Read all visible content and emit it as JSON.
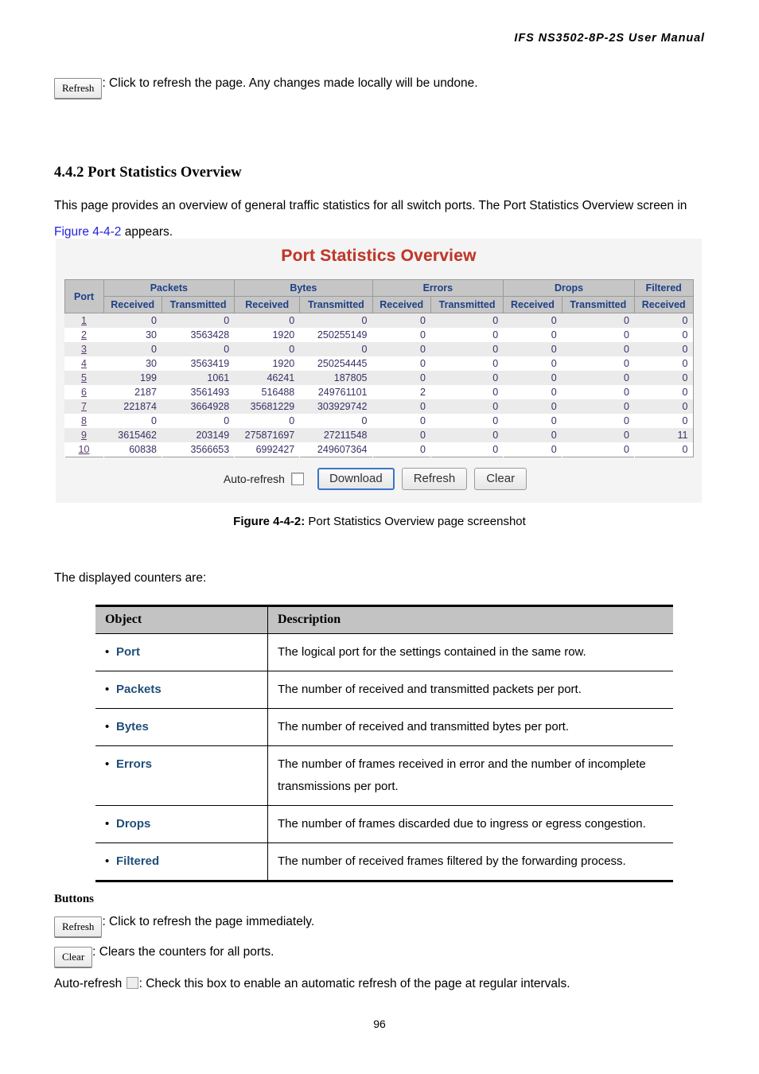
{
  "doc": {
    "running_header": "IFS  NS3502-8P-2S  User  Manual",
    "page_number": "96"
  },
  "intro": {
    "refresh_button_label": "Refresh",
    "refresh_text": ": Click to refresh the page. Any changes made locally will be undone.",
    "section_heading": "4.4.2 Port Statistics Overview",
    "paragraph_part1": "This page provides an overview of general traffic statistics for all switch ports. The Port Statistics Overview screen in ",
    "paragraph_link": "Figure 4-4-2",
    "paragraph_part2": " appears."
  },
  "figure": {
    "screen_title": "Port Statistics Overview",
    "caption_label": "Figure 4-4-2:",
    "caption_text": " Port Statistics Overview page screenshot",
    "controls": {
      "auto_refresh_label": "Auto-refresh",
      "download_label": "Download",
      "refresh_label": "Refresh",
      "clear_label": "Clear"
    },
    "table": {
      "port_header": "Port",
      "group_headers": [
        "Packets",
        "Bytes",
        "Errors",
        "Drops",
        "Filtered"
      ],
      "sub_headers": [
        "Received",
        "Transmitted",
        "Received",
        "Transmitted",
        "Received",
        "Transmitted",
        "Received",
        "Transmitted",
        "Received"
      ],
      "rows": [
        {
          "port": "1",
          "cells": [
            "0",
            "0",
            "0",
            "0",
            "0",
            "0",
            "0",
            "0",
            "0"
          ]
        },
        {
          "port": "2",
          "cells": [
            "30",
            "3563428",
            "1920",
            "250255149",
            "0",
            "0",
            "0",
            "0",
            "0"
          ]
        },
        {
          "port": "3",
          "cells": [
            "0",
            "0",
            "0",
            "0",
            "0",
            "0",
            "0",
            "0",
            "0"
          ]
        },
        {
          "port": "4",
          "cells": [
            "30",
            "3563419",
            "1920",
            "250254445",
            "0",
            "0",
            "0",
            "0",
            "0"
          ]
        },
        {
          "port": "5",
          "cells": [
            "199",
            "1061",
            "46241",
            "187805",
            "0",
            "0",
            "0",
            "0",
            "0"
          ]
        },
        {
          "port": "6",
          "cells": [
            "2187",
            "3561493",
            "516488",
            "249761101",
            "2",
            "0",
            "0",
            "0",
            "0"
          ]
        },
        {
          "port": "7",
          "cells": [
            "221874",
            "3664928",
            "35681229",
            "303929742",
            "0",
            "0",
            "0",
            "0",
            "0"
          ]
        },
        {
          "port": "8",
          "cells": [
            "0",
            "0",
            "0",
            "0",
            "0",
            "0",
            "0",
            "0",
            "0"
          ]
        },
        {
          "port": "9",
          "cells": [
            "3615462",
            "203149",
            "275871697",
            "27211548",
            "0",
            "0",
            "0",
            "0",
            "11"
          ]
        },
        {
          "port": "10",
          "cells": [
            "60838",
            "3566653",
            "6992427",
            "249607364",
            "0",
            "0",
            "0",
            "0",
            "0"
          ]
        }
      ]
    }
  },
  "counters": {
    "lead_in": "The displayed counters are:",
    "headers": [
      "Object",
      "Description"
    ],
    "rows": [
      {
        "object": "Port",
        "description": "The logical port for the settings contained in the same row."
      },
      {
        "object": "Packets",
        "description": "The number of received and transmitted packets per port."
      },
      {
        "object": "Bytes",
        "description": "The number of received and transmitted bytes per port."
      },
      {
        "object": "Errors",
        "description": "The number of frames received in error and the number of incomplete transmissions per port."
      },
      {
        "object": "Drops",
        "description": "The number of frames discarded due to ingress or egress congestion."
      },
      {
        "object": "Filtered",
        "description": "The number of received frames filtered by the forwarding process."
      }
    ]
  },
  "buttons_section": {
    "heading": "Buttons",
    "refresh_label": "Refresh",
    "refresh_text": ": Click to refresh the page immediately.",
    "clear_label": "Clear",
    "clear_text": ": Clears the counters for all ports.",
    "auto_refresh_label": "Auto-refresh ",
    "auto_refresh_text": ": Check this box to enable an automatic refresh of the page at regular intervals."
  },
  "colors": {
    "screen_title": "#c0392b",
    "link_blue": "#2222dd",
    "object_blue": "#1f4e79",
    "table_header_text": "#1d3f85"
  }
}
